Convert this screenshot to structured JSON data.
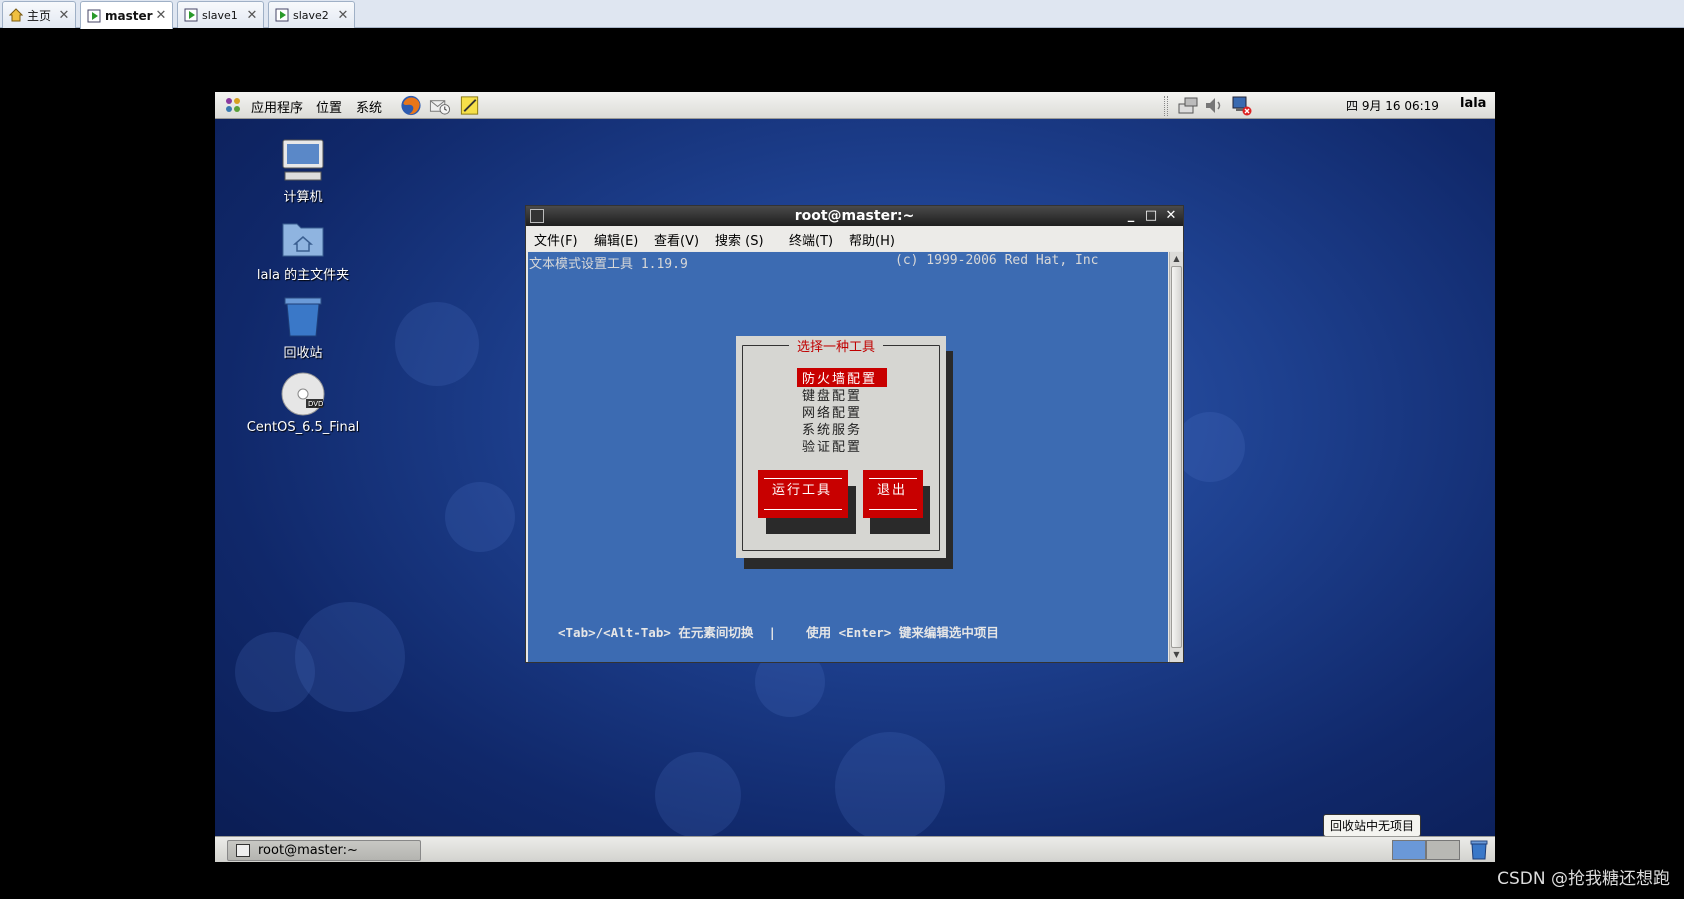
{
  "vm_tabs": [
    {
      "label": "主页",
      "icon": "home-icon"
    },
    {
      "label": "master",
      "icon": "vm-running-icon",
      "active": true
    },
    {
      "label": "slave1",
      "icon": "vm-running-icon"
    },
    {
      "label": "slave2",
      "icon": "vm-running-icon"
    }
  ],
  "top_panel": {
    "menus": [
      "应用程序",
      "位置",
      "系统"
    ],
    "launchers": [
      "firefox-icon",
      "mail-clock-icon",
      "notes-icon"
    ],
    "clock": "四 9月 16 06:19",
    "user": "lala"
  },
  "desktop_icons": [
    {
      "label": "计算机",
      "icon": "computer-icon"
    },
    {
      "label": "lala 的主文件夹",
      "icon": "home-folder-icon"
    },
    {
      "label": "回收站",
      "icon": "trash-icon"
    },
    {
      "label": "CentOS_6.5_Final",
      "icon": "dvd-icon"
    }
  ],
  "terminal": {
    "title": "root@master:~",
    "menus": [
      "文件(F)",
      "编辑(E)",
      "查看(V)",
      "搜索 (S)",
      "终端(T)",
      "帮助(H)"
    ],
    "header_left": "文本模式设置工具 1.19.9",
    "header_right": "(c) 1999-2006 Red Hat, Inc",
    "dialog": {
      "title": "选择一种工具",
      "items": [
        "防火墙配置",
        "键盘配置",
        "网络配置",
        "系统服务",
        "验证配置"
      ],
      "selected_index": 0,
      "run_button": "运行工具",
      "quit_button": "退出"
    },
    "help_line": "<Tab>/<Alt-Tab> 在元素间切换  |    使用 <Enter> 键来编辑选中项目"
  },
  "bottom_panel": {
    "task": "root@master:~",
    "tooltip": "回收站中无项目"
  },
  "watermark": "CSDN @抢我糖还想跑",
  "colors": {
    "newt_blue": "#3c6bb2",
    "newt_red": "#c80000",
    "dialog_gray": "#d6d6d2"
  }
}
